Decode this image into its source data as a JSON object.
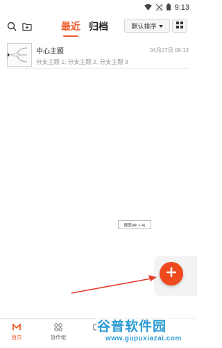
{
  "status_bar": {
    "time": "9:13",
    "icons": [
      "wifi-icon",
      "signal-icon",
      "battery-icon"
    ]
  },
  "toolbar": {
    "tabs": [
      {
        "label": "最近",
        "active": true
      },
      {
        "label": "归档",
        "active": false
      }
    ],
    "sort_label": "默认排序",
    "icons": [
      "search-icon",
      "new-folder-icon",
      "grid-view-icon",
      "caret-down-icon"
    ]
  },
  "files": [
    {
      "title": "中心主题",
      "subtitle": "分支主题 1, 分支主题 2, 分支主题 3",
      "date": "04月27日 09:13"
    }
  ],
  "screenshot_tip": "截图(Alt + A)",
  "fab": {
    "icon": "plus-icon"
  },
  "bottom_nav": [
    {
      "label": "首页",
      "icon": "home-logo-icon",
      "active": true
    },
    {
      "label": "协作组",
      "icon": "group-icon",
      "active": false
    },
    {
      "label": "",
      "icon": "device-icon",
      "active": false
    }
  ],
  "watermark": {
    "title": "谷普软件园",
    "url": "www.gupuxiazai.com"
  },
  "colors": {
    "accent": "#ee5a2b",
    "fab": "#ee4a1e",
    "watermark": "#2c9ad3",
    "arrow": "#e53a2a"
  }
}
